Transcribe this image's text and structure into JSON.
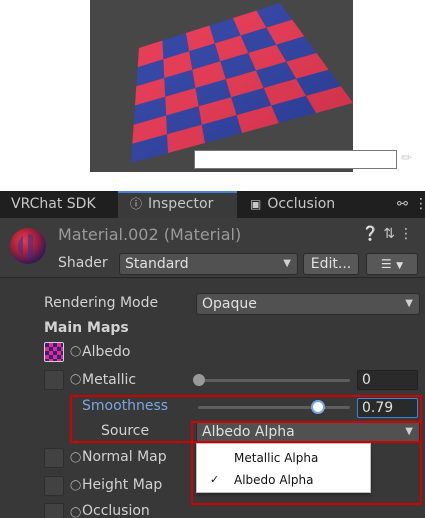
{
  "tabs": {
    "sdk": "VRChat SDK",
    "inspector": "Inspector",
    "occlusion": "Occlusion",
    "inspector_icon": "info-icon",
    "occlusion_icon": "occlusion-icon"
  },
  "header": {
    "title": "Material.002 (Material)",
    "shader_label": "Shader",
    "shader_value": "Standard",
    "edit_button": "Edit...",
    "icons": [
      "help-icon",
      "preset-icon",
      "more-icon"
    ]
  },
  "properties": {
    "rendering_mode_label": "Rendering Mode",
    "rendering_mode_value": "Opaque",
    "main_maps": "Main Maps",
    "albedo": "Albedo",
    "metallic": "Metallic",
    "metallic_value": "0",
    "smoothness": "Smoothness",
    "smoothness_value": "0.79",
    "smoothness_level": 0.79,
    "source_label": "Source",
    "source_value": "Albedo Alpha",
    "normal_map": "Normal Map",
    "height_map": "Height Map",
    "occlusion": "Occlusion"
  },
  "source_popup": {
    "options": [
      {
        "label": "Metallic Alpha",
        "checked": false
      },
      {
        "label": "Albedo Alpha",
        "checked": true
      }
    ],
    "check_mark": "✓"
  },
  "colors": {
    "accent": "#3b86d6",
    "highlight_box": "#d20000",
    "checker_red": "#e8334f",
    "checker_blue": "#2b3ea3"
  }
}
